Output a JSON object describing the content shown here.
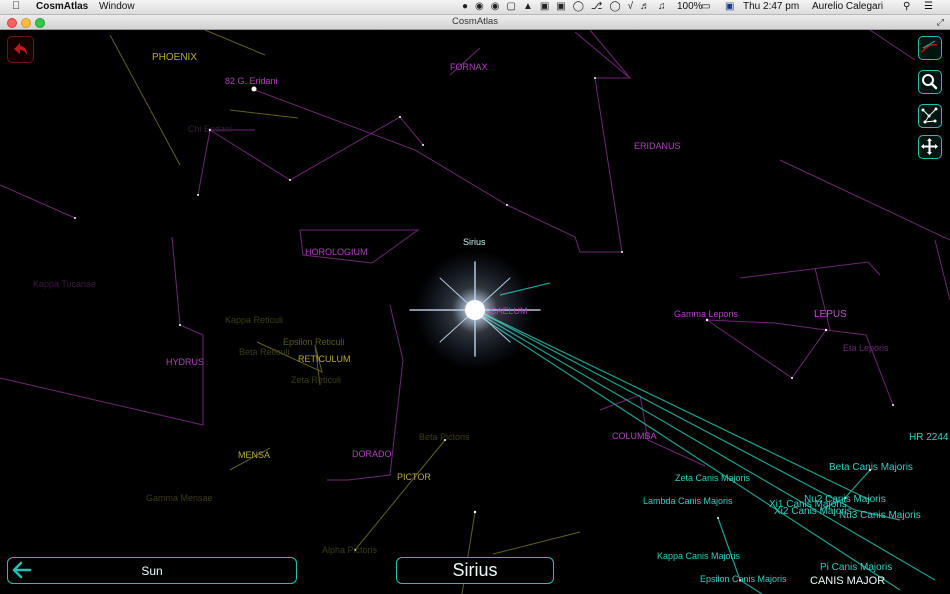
{
  "menubar": {
    "app_name": "CosmAtlas",
    "menu_window": "Window",
    "battery": "100%",
    "clock": "Thu 2:47 pm",
    "user": "Aurelio Calegari"
  },
  "window": {
    "title": "CosmAtlas"
  },
  "constellations": {
    "phoenix": "PHOENIX",
    "fornax": "FORNAX",
    "eridanus": "ERIDANUS",
    "horologium": "HOROLOGIUM",
    "hydrus": "HYDRUS",
    "reticulum": "RETICULUM",
    "caelum": "CAELUM",
    "lepus": "LEPUS",
    "columba": "COLUMBA",
    "mensa": "MENSA",
    "dorado": "DORADO",
    "pictor": "PICTOR",
    "canis_major": "CANIS MAJOR"
  },
  "stars": {
    "sirius": "Sirius",
    "g82_eridani": "82 G. Eridani",
    "gamma_leporis": "Gamma Leporis",
    "eta_leporis": "Eta Leporis",
    "hr2244": "HR 2244",
    "beta_canis_majoris": "Beta Canis Majoris",
    "nu2_canis_majoris": "Nu2 Canis Majoris",
    "nu3_canis_majoris": "Nu3 Canis Majoris",
    "xi1_canis_majoris": "Xi1 Canis Majoris",
    "xi2_canis_majoris": "Xi2 Canis Majoris",
    "zeta_canis_majoris": "Zeta Canis Majoris",
    "lambda_canis_majoris": "Lambda Canis Majoris",
    "kappa_canis_majoris": "Kappa Canis Majoris",
    "epsilon_canis_majoris": "Epsilon Canis Majoris",
    "pi_canis_majoris": "Pi Canis Majoris",
    "beta_reticuli": "Beta Reticuli",
    "epsilon_reticuli": "Epsilon Reticuli",
    "zeta_reticuli": "Zeta Reticuli",
    "kappa_reticuli": "Kappa Reticuli",
    "beta_pictoris": "Beta Pictoris",
    "alpha_pictoris": "Alpha Pictoris",
    "gamma_mensae": "Gamma Mensae",
    "kappa_tucanae": "Kappa Tucanae",
    "chi_eridani": "Chi Eridani"
  },
  "nav": {
    "origin_label": "Sun",
    "target_label": "Sirius"
  },
  "icons": {
    "back": "back-arrow-icon",
    "search": "search-icon",
    "constellations": "constellation-icon",
    "move": "move-icon",
    "view": "view-icon"
  },
  "colors": {
    "accent": "#25c0b4",
    "constellation_label": "#b040c0",
    "star_label": "#30d0c0"
  }
}
